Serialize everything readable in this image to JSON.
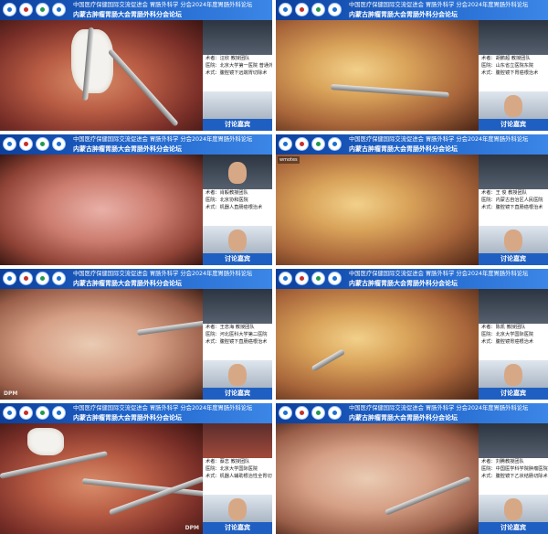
{
  "banner": {
    "line1": "中国医疗保健国际交流促进会 胃肠外科学 分会2024年度胃肠外科论坛",
    "line2": "内蒙古肿瘤胃肠大会胃肠外科分会论坛"
  },
  "discuss_label": "讨论嘉宾",
  "dpm_label": "DPM",
  "tiles": [
    {
      "info": [
        "术者：汪欣 教授团队",
        "医院：北京大学第一医院 普通外科",
        "术式：腹腔镜下远端胃切除术"
      ]
    },
    {
      "info": [
        "术者：胡鹏超 教授团队",
        "医院：山东省立医院东院",
        "术式：腹腔镜下胃癌根治术"
      ]
    },
    {
      "info": [
        "术者：肖毅教授团队",
        "医院：北京协和医院",
        "术式：机器人直肠癌根治术"
      ]
    },
    {
      "info": [
        "术者：王 俊 教授团队",
        "医院：内蒙古自治区人民医院",
        "术式：腹腔镜下直肠癌根治术"
      ]
    },
    {
      "info": [
        "术者：王忠海 教授团队",
        "医院：河北医科大学第二医院",
        "术式：腹腔镜下直肠癌根治术"
      ]
    },
    {
      "info": [
        "术者：陈凯 教授团队",
        "医院：北京大学国际医院",
        "术式：腹腔镜胃癌根治术"
      ]
    },
    {
      "info": [
        "术者：蔡志 教授团队",
        "医院：北京大学国际医院",
        "术式：机器人辅助根治性全胃切除术"
      ]
    },
    {
      "info": [
        "术者：刘腾教授团队",
        "医院：中国医学科学院肿瘤医院",
        "术式：腹腔镜下乙状结肠切除术"
      ]
    }
  ],
  "ui": {
    "corner_text": "wmotes"
  }
}
